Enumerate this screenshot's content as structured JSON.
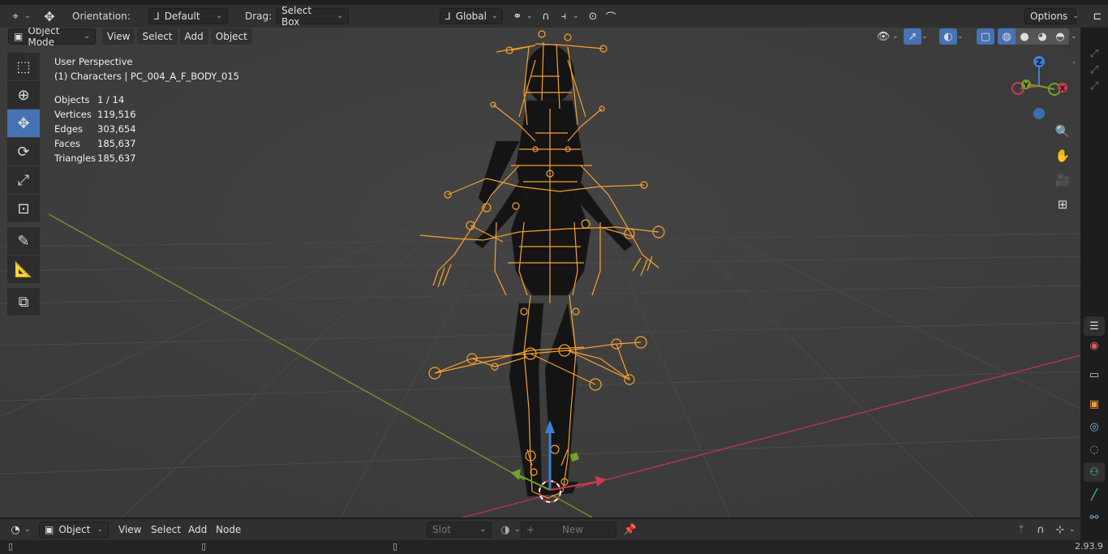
{
  "header": {
    "orientation_label": "Orientation:",
    "orientation_value": "Default",
    "drag_label": "Drag:",
    "drag_value": "Select Box",
    "transform_orientation": "Global",
    "options_label": "Options"
  },
  "viewport_header": {
    "mode": "Object Mode",
    "menu": [
      "View",
      "Select",
      "Add",
      "Object"
    ]
  },
  "overlay": {
    "perspective": "User Perspective",
    "active": "(1) Characters | PC_004_A_F_BODY_015",
    "stats": [
      {
        "label": "Objects",
        "value": "1 / 14"
      },
      {
        "label": "Vertices",
        "value": "119,516"
      },
      {
        "label": "Edges",
        "value": "303,654"
      },
      {
        "label": "Faces",
        "value": "185,637"
      },
      {
        "label": "Triangles",
        "value": "185,637"
      }
    ]
  },
  "gizmo": {
    "x": "X",
    "y": "Y",
    "z": "Z"
  },
  "toolbar_icons": [
    "select-box-icon",
    "cursor-icon",
    "move-icon",
    "rotate-icon",
    "scale-icon",
    "transform-icon",
    "annotate-icon",
    "measure-icon",
    "add-cube-icon"
  ],
  "bottom": {
    "editor_type": "Object",
    "menu": [
      "View",
      "Select",
      "Add",
      "Node"
    ],
    "slot_placeholder": "Slot",
    "new_label": "New"
  },
  "status": {
    "version": "2.93.9"
  },
  "colors": {
    "armature": "#f7a12d",
    "active_tool": "#4772b3",
    "x_axis": "#c93d50",
    "y_axis": "#72a22a",
    "z_axis": "#3e7fd6"
  }
}
